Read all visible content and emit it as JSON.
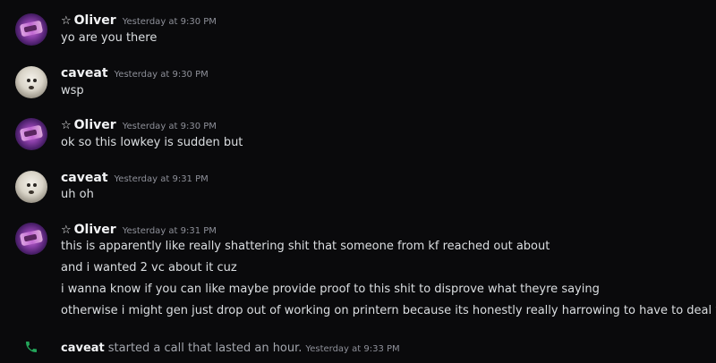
{
  "messages": [
    {
      "author": "Oliver",
      "star": "☆",
      "timestamp": "Yesterday at 9:30 PM",
      "lines": [
        "yo are you there"
      ]
    },
    {
      "author": "caveat",
      "timestamp": "Yesterday at 9:30 PM",
      "lines": [
        "wsp"
      ]
    },
    {
      "author": "Oliver",
      "star": "☆",
      "timestamp": "Yesterday at 9:30 PM",
      "lines": [
        "ok so this lowkey is sudden but"
      ]
    },
    {
      "author": "caveat",
      "timestamp": "Yesterday at 9:31 PM",
      "lines": [
        "uh oh"
      ]
    },
    {
      "author": "Oliver",
      "star": "☆",
      "timestamp": "Yesterday at 9:31 PM",
      "lines": [
        "this is apparently like really shattering shit that someone from kf reached out about",
        "and i wanted 2 vc about it cuz",
        "i wanna know if you can like maybe provide proof to this shit to disprove what theyre saying",
        "otherwise i might gen just drop out of working on printern because its honestly really harrowing to have to deal w this"
      ]
    }
  ],
  "call": {
    "icon": "phone-icon",
    "user": "caveat",
    "description": "started a call that lasted an hour.",
    "timestamp": "Yesterday at 9:33 PM"
  },
  "colors": {
    "background": "#0a0a0c",
    "username": "#f2f3f5",
    "text": "#dbdee1",
    "timestamp": "#8e9099",
    "call_icon": "#23a55a"
  }
}
